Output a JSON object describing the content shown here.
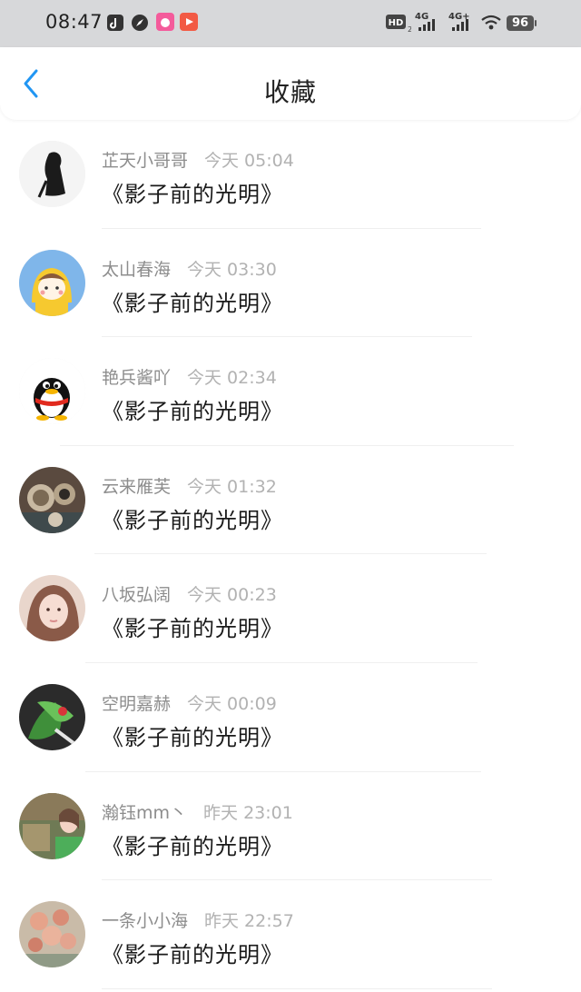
{
  "status_bar": {
    "time": "08:47",
    "hd_label": "HD",
    "network_1": "4G",
    "network_2": "4G+",
    "battery": "96"
  },
  "header": {
    "title": "收藏"
  },
  "items": [
    {
      "name": "芷天小哥哥",
      "time": "今天 05:04",
      "title": "《影子前的光明》"
    },
    {
      "name": "太山春海",
      "time": "今天 03:30",
      "title": "《影子前的光明》"
    },
    {
      "name": "艳兵酱吖",
      "time": "今天 02:34",
      "title": "《影子前的光明》"
    },
    {
      "name": "云来雁芙",
      "time": "今天 01:32",
      "title": "《影子前的光明》"
    },
    {
      "name": "八坂弘阔",
      "time": "今天 00:23",
      "title": "《影子前的光明》"
    },
    {
      "name": "空明嘉赫",
      "time": "今天 00:09",
      "title": "《影子前的光明》"
    },
    {
      "name": "瀚钰mm丶",
      "time": "昨天 23:01",
      "title": "《影子前的光明》"
    },
    {
      "name": "一条小小海",
      "time": "昨天 22:57",
      "title": "《影子前的光明》"
    }
  ],
  "colors": {
    "accent": "#2196f3",
    "status_bar_bg": "#d7d8da",
    "name_text": "#8d8d8d",
    "time_text": "#b2b2b2"
  }
}
